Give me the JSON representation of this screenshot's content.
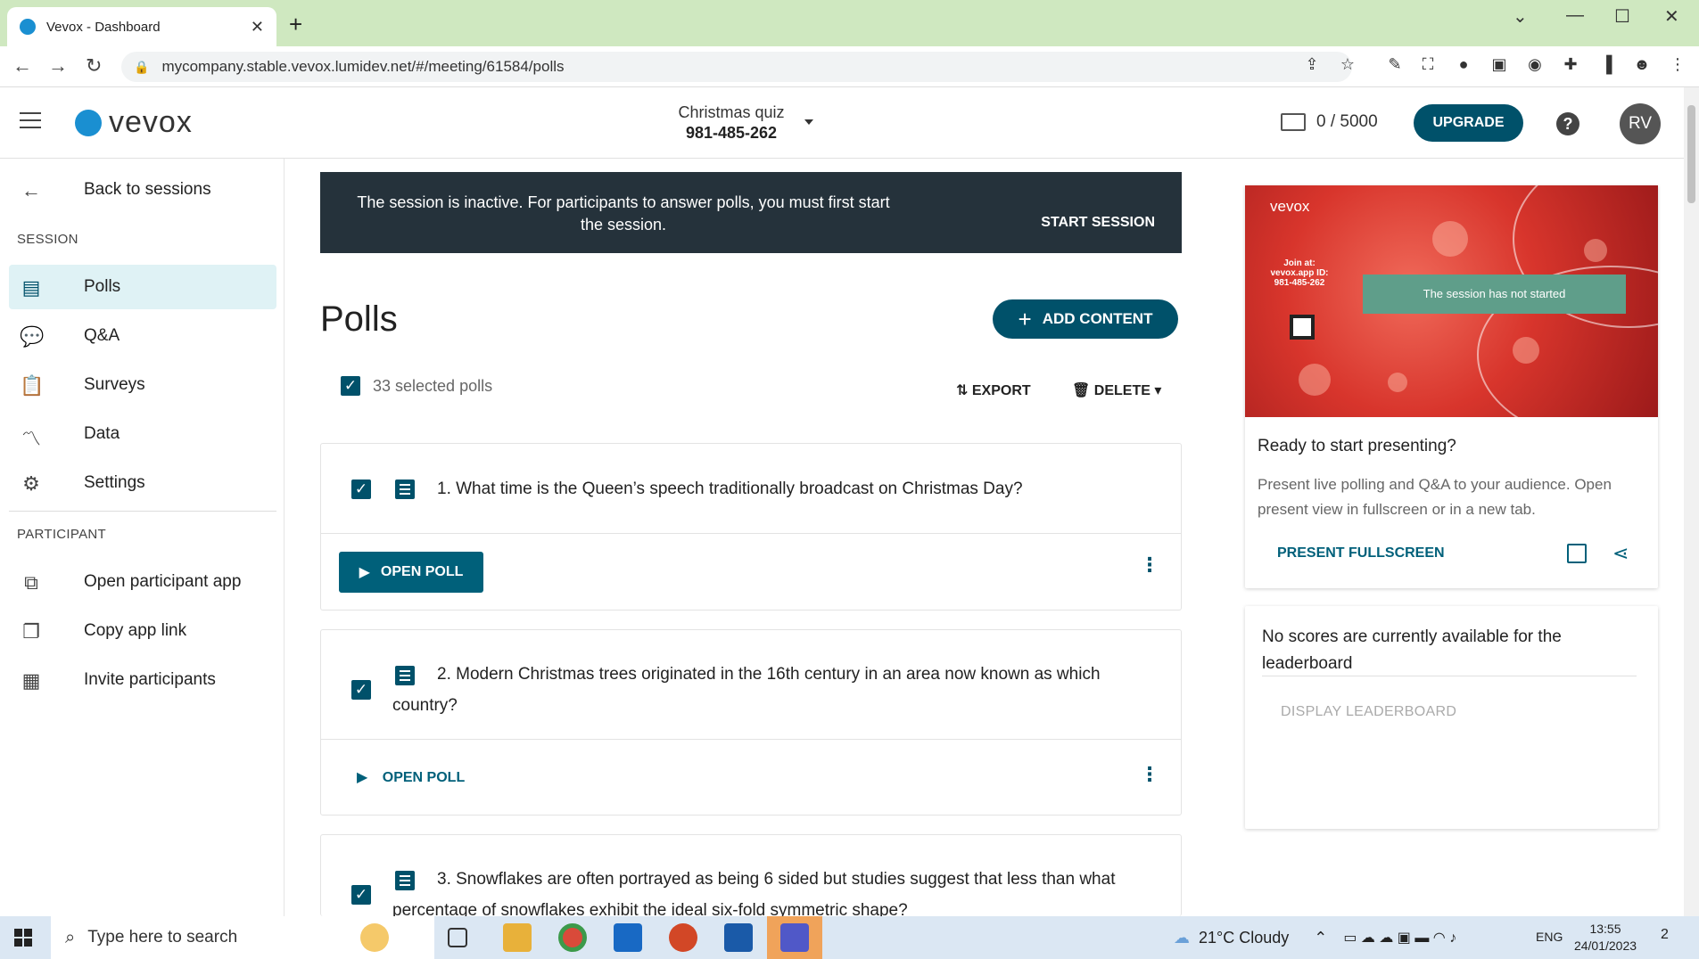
{
  "browser": {
    "tab_title": "Vevox - Dashboard",
    "url": "mycompany.stable.vevox.lumidev.net/#/meeting/61584/polls"
  },
  "header": {
    "logo_text": "vevox",
    "session_name": "Christmas quiz",
    "session_id": "981-485-262",
    "counter": "0 / 5000",
    "upgrade_label": "UPGRADE",
    "help_label": "?",
    "avatar_initials": "RV"
  },
  "sidebar": {
    "back_label": "Back to sessions",
    "session_heading": "SESSION",
    "session_items": [
      {
        "label": "Polls",
        "icon": "polls-icon",
        "active": true
      },
      {
        "label": "Q&A",
        "icon": "qa-icon"
      },
      {
        "label": "Surveys",
        "icon": "surveys-icon"
      },
      {
        "label": "Data",
        "icon": "data-icon"
      },
      {
        "label": "Settings",
        "icon": "gear-icon"
      }
    ],
    "participant_heading": "PARTICIPANT",
    "participant_items": [
      {
        "label": "Open participant app",
        "icon": "external-link-icon"
      },
      {
        "label": "Copy app link",
        "icon": "copy-icon"
      },
      {
        "label": "Invite participants",
        "icon": "calendar-icon"
      }
    ]
  },
  "banner": {
    "message": "The session is inactive. For participants to answer polls, you must first start the session.",
    "action_label": "START SESSION"
  },
  "main": {
    "title": "Polls",
    "add_content_label": "ADD CONTENT",
    "selected_label": "33 selected polls",
    "export_label": "EXPORT",
    "delete_label": "DELETE",
    "polls": [
      {
        "question": "1. What time is the Queen’s speech traditionally broadcast on Christmas Day?",
        "open_label": "OPEN POLL"
      },
      {
        "question": "2. Modern Christmas trees originated in the 16th century in an area now known as which country?",
        "open_label": "OPEN POLL"
      },
      {
        "question": "3. Snowflakes are often portrayed as being 6 sided but studies suggest that less than what percentage of snowflakes exhibit the ideal six-fold symmetric shape?"
      }
    ]
  },
  "preview": {
    "slide_logo": "vevox",
    "slide_join": "Join at: vevox.app ID: 981-485-262",
    "slide_notice": "The session has not started",
    "ready_title": "Ready to start presenting?",
    "description": "Present live polling and Q&A to your audience. Open present view in fullscreen or in a new tab.",
    "present_label": "PRESENT FULLSCREEN"
  },
  "leaderboard": {
    "message": "No scores are currently available for the leaderboard",
    "display_label": "DISPLAY LEADERBOARD"
  },
  "taskbar": {
    "search_placeholder": "Type here to search",
    "weather": "21°C  Cloudy",
    "language": "ENG",
    "time": "13:55",
    "date": "24/01/2023",
    "notifications": "2"
  },
  "colors": {
    "brand_dark": "#00516a",
    "banner": "#25323b",
    "sidebar_active": "#dff2f5",
    "chrome_frame": "#cfe8c0"
  }
}
